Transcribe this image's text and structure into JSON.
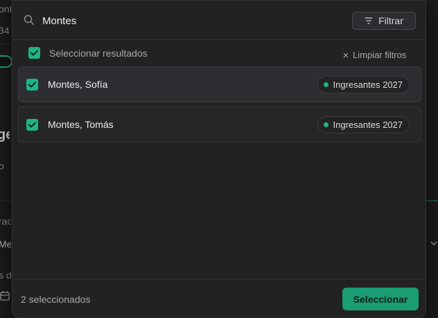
{
  "background": {
    "fragments": [
      "ont",
      "34",
      "ge",
      "o",
      "rac",
      "Me",
      "s d"
    ],
    "colors": {
      "accent": "#1db584"
    }
  },
  "search": {
    "value": "Montes",
    "placeholder": "",
    "icon": "search-icon"
  },
  "filter_button": {
    "label": "Filtrar",
    "icon": "filter-icon"
  },
  "select_all": {
    "label": "Seleccionar resultados",
    "checked": true
  },
  "clear_filters": {
    "label": "Limpiar filtros",
    "icon": "close-icon"
  },
  "results": [
    {
      "name": "Montes, Sofía",
      "badge": "Ingresantes 2027",
      "checked": true
    },
    {
      "name": "Montes, Tomás",
      "badge": "Ingresantes 2027",
      "checked": true
    }
  ],
  "footer": {
    "selected_count": "2 seleccionados",
    "select_button": "Seleccionar"
  }
}
